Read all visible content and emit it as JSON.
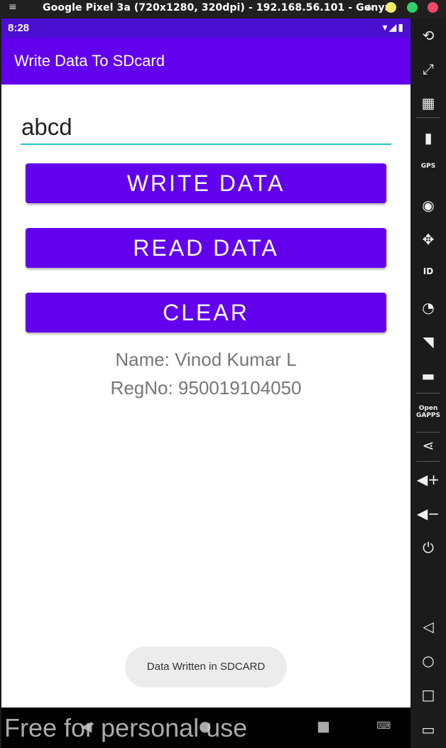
{
  "window": {
    "menu_icon": "hamburger-icon",
    "title": "Google Pixel 3a (720x1280, 320dpi) - 192.168.56.101 - Genym"
  },
  "status": {
    "time": "8:28",
    "icons": "▾◢▮"
  },
  "app": {
    "title": "Write Data To SDcard",
    "input_value": "abcd",
    "buttons": [
      "WRITE DATA",
      "READ DATA",
      "CLEAR"
    ],
    "name_line": "Name: Vinod Kumar L",
    "reg_line": "RegNo: 950019104050",
    "toast": "Data Written in SDCARD",
    "accent": "#6200ee",
    "underline": "#26c6c6"
  },
  "overlay": {
    "watermark": "Free for personal use"
  },
  "toolbar": {
    "items": [
      "rotate",
      "1:1",
      "capture",
      "battery",
      "GPS",
      "camera",
      "move",
      "ID",
      "disk",
      "cast",
      "sms",
      "Open GAPPS",
      "share",
      "vol+",
      "vol-",
      "power",
      "back",
      "home",
      "recent",
      "menu"
    ]
  }
}
